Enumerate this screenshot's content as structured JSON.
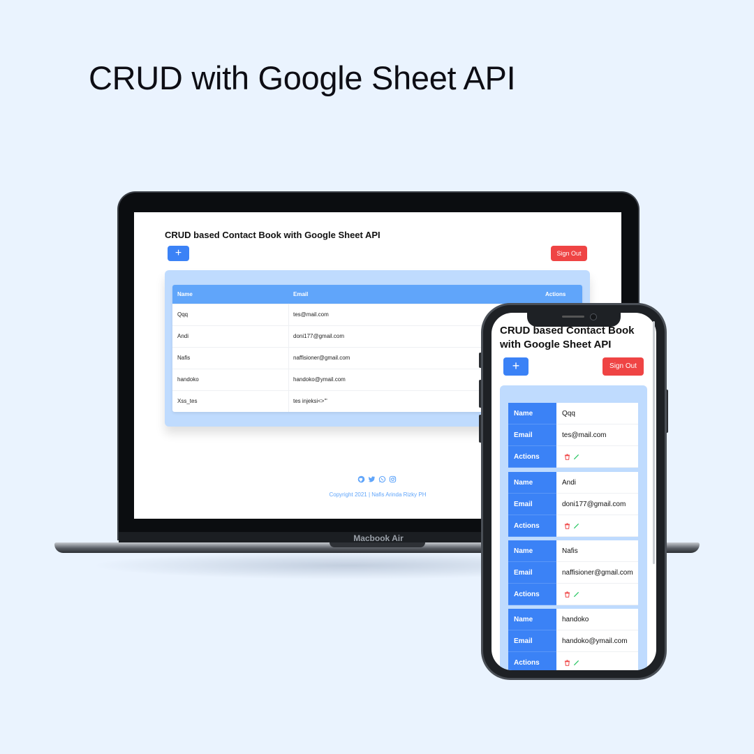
{
  "headline": "CRUD with Google Sheet API",
  "device_label": "Macbook Air",
  "app": {
    "title": "CRUD based Contact Book with Google Sheet API",
    "add_label": "+",
    "signout_label": "Sign Out",
    "columns": {
      "name": "Name",
      "email": "Email",
      "actions": "Actions"
    },
    "contacts": [
      {
        "name": "Qqq",
        "email": "tes@mail.com"
      },
      {
        "name": "Andi",
        "email": "doni177@gmail.com"
      },
      {
        "name": "Nafis",
        "email": "naffisioner@gmail.com"
      },
      {
        "name": "handoko",
        "email": "handoko@ymail.com"
      },
      {
        "name": "Xss_tes",
        "email": "tes injeksi<>\"'"
      }
    ],
    "footer": {
      "social_icons": [
        "github-icon",
        "twitter-icon",
        "whatsapp-icon",
        "instagram-icon"
      ],
      "copyright": "Copyright 2021 | Nafis Arinda Rizky PH"
    }
  },
  "colors": {
    "page_bg": "#eaf3fe",
    "primary": "#3b82f6",
    "header_blue": "#60a5fa",
    "panel_blue": "#bfdbfe",
    "danger": "#ef4444",
    "edit_green": "#22c55e"
  }
}
